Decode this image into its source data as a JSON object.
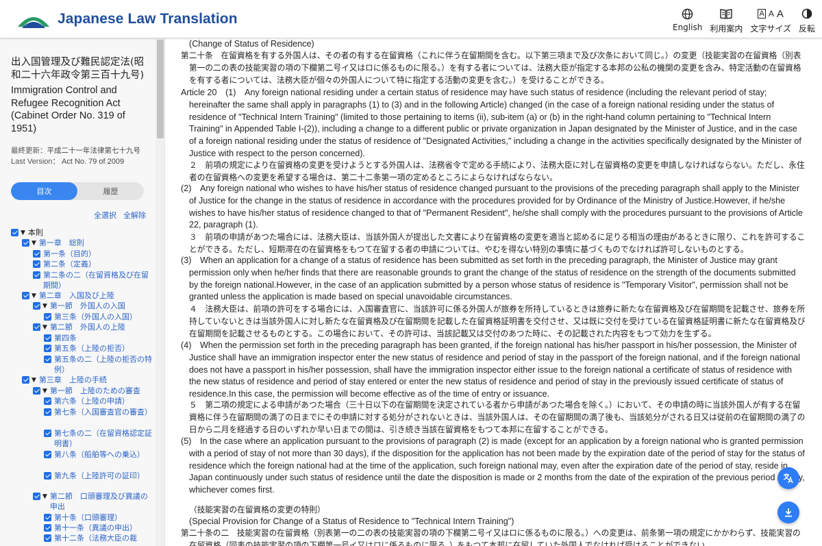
{
  "header": {
    "site_title": "Japanese Law Translation",
    "tools": [
      {
        "label": "English",
        "icon": "globe-icon"
      },
      {
        "label": "利用案内",
        "icon": "book-icon"
      },
      {
        "label": "文字サイズ",
        "icon": "font-size-icon"
      },
      {
        "label": "反転",
        "icon": "contrast-icon"
      }
    ],
    "font_size_glyphs": [
      "A",
      "A",
      "A"
    ]
  },
  "sidebar": {
    "law_title_ja": "出入国管理及び難民認定法(昭和二十六年政令第三百十九号)",
    "law_title_en": "Immigration Control and Refugee Recognition Act (Cabinet Order No. 319 of 1951)",
    "last_update_ja_label": "最終更新：",
    "last_update_ja_value": "平成二十一年法律第七十九号",
    "last_version_label": "Last Version：",
    "last_version_value": "Act No. 79 of 2009",
    "tabs": [
      "目次",
      "履歴"
    ],
    "select_all": "全選択",
    "deselect_all": "全解除",
    "toc": [
      {
        "label": "本則",
        "level": 0,
        "arrow": true
      },
      {
        "label": "第一章　総則",
        "level": 1,
        "arrow": true
      },
      {
        "label": "第一条（目的）",
        "level": 2,
        "arrow": false
      },
      {
        "label": "第二条（定義）",
        "level": 2,
        "arrow": false
      },
      {
        "label": "第二条の二（在留資格及び在留期間）",
        "level": 2,
        "arrow": false
      },
      {
        "label": "第二章　入国及び上陸",
        "level": 1,
        "arrow": true
      },
      {
        "label": "第一節　外国人の入国",
        "level": 2,
        "arrow": true
      },
      {
        "label": "第三条（外国人の入国）",
        "level": 3,
        "arrow": false
      },
      {
        "label": "第二節　外国人の上陸",
        "level": 2,
        "arrow": true
      },
      {
        "label": "第四条",
        "level": 3,
        "arrow": false
      },
      {
        "label": "第五条（上陸の拒否）",
        "level": 3,
        "arrow": false
      },
      {
        "label": "第五条の二（上陸の拒否の特例）",
        "level": 3,
        "arrow": false
      },
      {
        "label": "第三章　上陸の手続",
        "level": 1,
        "arrow": true
      },
      {
        "label": "第一節　上陸のための審査",
        "level": 2,
        "arrow": true
      },
      {
        "label": "第六条（上陸の申請）",
        "level": 3,
        "arrow": false
      },
      {
        "label": "第七条（入国審査官の審査）",
        "level": 3,
        "arrow": false
      },
      {
        "label": "第七条の二（在留資格認定証明書）",
        "level": 3,
        "arrow": false
      },
      {
        "label": "第八条（船舶等への乗込）",
        "level": 3,
        "arrow": false
      },
      {
        "label": "第九条（上陸許可の証印）",
        "level": 3,
        "arrow": false
      },
      {
        "label": "第二節　口頭審理及び異議の申出",
        "level": 2,
        "arrow": true
      },
      {
        "label": "第十条（口頭審理）",
        "level": 3,
        "arrow": false
      },
      {
        "label": "第十一条（異議の申出）",
        "level": 3,
        "arrow": false
      },
      {
        "label": "第十二条（法務大臣の裁",
        "level": 3,
        "arrow": false
      }
    ]
  },
  "main": {
    "caption_20_en": "(Change of Status of Residence)",
    "art20_ja": "第二十条　在留資格を有する外国人は、その者の有する在留資格（これに伴う在留期間を含む。以下第三項まで及び次条において同じ。）の変更（技能実習の在留資格（別表第一の二の表の技能実習の項の下欄第二号イ又はロに係るものに限る。）を有する者については、法務大臣が指定する本邦の公私の機関の変更を含み、特定活動の在留資格を有する者については、法務大臣が個々の外国人について特に指定する活動の変更を含む。）を受けることができる。",
    "art20_en": "Article 20　(1)　Any foreign national residing under a certain status of residence may have such status of residence (including the relevant period of stay; hereinafter the same shall apply in paragraphs (1) to (3) and in the following Article) changed (in the case of a foreign national residing under the status of residence of \"Technical Intern Training\" (limited to those pertaining to items (ii), sub-item (a) or (b) in the right-hand column pertaining to \"Technical Intern Training\" in Appended Table I-(2)), including a change to a different public or private organization in Japan designated by the Minister of Justice, and in the case of a foreign national residing under the status of residence of \"Designated Activities,\" including a change in the activities specifically designated by the Minister of Justice with respect to the person concerned).",
    "p2_ja": "２　前項の規定により在留資格の変更を受けようとする外国人は、法務省令で定める手続により、法務大臣に対し在留資格の変更を申請しなければならない。ただし、永住者の在留資格への変更を希望する場合は、第二十二条第一項の定めるところによらなければならない。",
    "p2_en": "(2)　Any foreign national who wishes to have his/her status of residence changed pursuant to the provisions of the preceding paragraph shall apply to the Minister of Justice for the change in the status of residence in accordance with the procedures provided for by Ordinance of the Ministry of Justice.However, if he/she wishes to have his/her status of residence changed to that of \"Permanent Resident\", he/she shall comply with the procedures pursuant to the provisions of Article 22, paragraph (1).",
    "p3_ja": "３　前項の申請があつた場合には、法務大臣は、当該外国人が提出した文書により在留資格の変更を適当と認めるに足りる相当の理由があるときに限り、これを許可することができる。ただし、短期滞在の在留資格をもつて在留する者の申請については、やむを得ない特別の事情に基づくものでなければ許可しないものとする。",
    "p3_en": "(3)　When an application for a change of a status of residence has been submitted as set forth in the preceding paragraph, the Minister of Justice may grant permission only when he/her finds that there are reasonable grounds to grant the change of the status of residence on the strength of the documents submitted by the foreign national.However, in the case of an application submitted by a person whose status of residence is \"Temporary Visitor\", permission shall not be granted unless the application is made based on special unavoidable circumstances.",
    "p4_ja": "４　法務大臣は、前項の許可をする場合には、入国審査官に、当該許可に係る外国人が旅券を所持しているときは旅券に新たな在留資格及び在留期間を記載させ、旅券を所持していないときは当該外国人に対し新たな在留資格及び在留期間を記載した在留資格証明書を交付させ、又は既に交付を受けている在留資格証明書に新たな在留資格及び在留期間を記載させるものとする。この場合において、その許可は、当該記載又は交付のあつた時に、その記載された内容をもつて効力を生ずる。",
    "p4_en": "(4)　When the permission set forth in the preceding paragraph has been granted, if the foreign national has his/her passport in his/her possession, the Minister of Justice shall have an immigration inspector enter the new status of residence and period of stay in the passport of the foreign national, and if the foreign national does not have a passport in his/her possession, shall have the immigration inspector either issue to the foreign national a certificate of status of residence with the new status of residence and period of stay entered or enter the new status of residence and period of stay in the previously issued certificate of status of residence.In this case, the permission will become effective as of the time of entry or issuance.",
    "p5_ja": "５　第二項の規定による申請があつた場合（三十日以下の在留期間を決定されている者から申請があつた場合を除く。）において、その申請の時に当該外国人が有する在留資格に伴う在留期間の満了の日までにその申請に対する処分がされないときは、当該外国人は、その在留期間の満了後も、当該処分がされる日又は従前の在留期間の満了の日から二月を経過する日のいずれか早い日までの間は、引き続き当該在留資格をもつて本邦に在留することができる。",
    "p5_en": "(5)　In the case where an application pursuant to the provisions of paragraph (2) is made (except for an application by a foreign national who is granted permission with a period of stay of not more than 30 days), if the disposition for the application has not been made by the expiration date of the period of stay for the status of residence which the foreign national had at the time of the application, such foreign national may, even after the expiration date of the period of stay, reside in Japan continuously under such status of residence until the date the disposition is made or 2 months from the date of the expiration of the previous period of stay, whichever comes first.",
    "caption_202_ja": "（技能実習の在留資格の変更の特則）",
    "caption_202_en": "(Special Provision for Change of a Status of Residence to \"Technical Intern Training\")",
    "art202_ja": "第二十条の二　技能実習の在留資格（別表第一の二の表の技能実習の項の下欄第二号イ又はロに係るものに限る。）への変更は、前条第一項の規定にかかわらず、技能実習の在留資格（同表の技能実習の項の下欄第一号イ又はロに係るものに限る。）をもつて本邦に在留していた外国人でなければ受けることができない。"
  }
}
